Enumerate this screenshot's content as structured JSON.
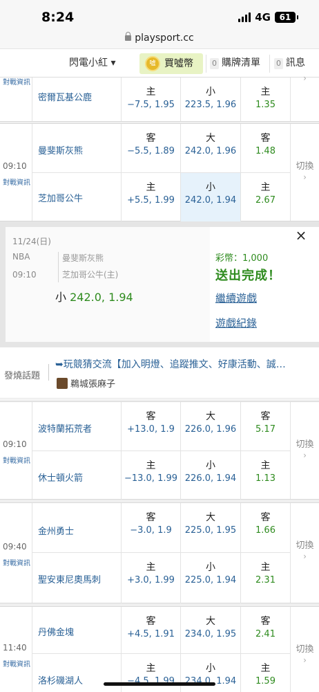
{
  "status_bar": {
    "time": "8:24",
    "network": "4G",
    "battery": "61"
  },
  "url": "playsport.cc",
  "nav": {
    "menu_label": "閃電小紅 ▾",
    "buy_label": "買噓幣",
    "coin_icon_text": "噓",
    "cart_count": "0",
    "cart_label": "購牌清單",
    "msg_count": "0",
    "msg_label": "訊息"
  },
  "labels": {
    "info": "對戰資訊",
    "switch": "切換",
    "switch_arrow": "›"
  },
  "game_top": {
    "team": "密爾瓦基公鹿",
    "col1": [
      "主",
      "−7.5, 1.95"
    ],
    "col2": [
      "小",
      "223.5, 1.96"
    ],
    "col3": [
      "主",
      "1.35"
    ]
  },
  "games": [
    {
      "time": "09:10",
      "away": {
        "team": "曼斐斯灰熊",
        "c1": [
          "客",
          "−5.5, 1.89"
        ],
        "c2": [
          "大",
          "242.0, 1.96"
        ],
        "c3": [
          "客",
          "1.48"
        ]
      },
      "home": {
        "team": "芝加哥公牛",
        "c1": [
          "主",
          "+5.5, 1.99"
        ],
        "c2": [
          "小",
          "242.0, 1.94"
        ],
        "c3": [
          "主",
          "2.67"
        ]
      }
    },
    {
      "time": "09:10",
      "away": {
        "team": "波特蘭拓荒者",
        "c1": [
          "客",
          "+13.0, 1.9"
        ],
        "c2": [
          "大",
          "226.0, 1.96"
        ],
        "c3": [
          "客",
          "5.17"
        ]
      },
      "home": {
        "team": "休士頓火箭",
        "c1": [
          "主",
          "−13.0, 1.99"
        ],
        "c2": [
          "小",
          "226.0, 1.94"
        ],
        "c3": [
          "主",
          "1.13"
        ]
      }
    },
    {
      "time": "09:40",
      "away": {
        "team": "金州勇士",
        "c1": [
          "客",
          "−3.0, 1.9"
        ],
        "c2": [
          "大",
          "225.0, 1.95"
        ],
        "c3": [
          "客",
          "1.66"
        ]
      },
      "home": {
        "team": "聖安東尼奧馬刺",
        "c1": [
          "主",
          "+3.0, 1.99"
        ],
        "c2": [
          "小",
          "225.0, 1.94"
        ],
        "c3": [
          "主",
          "2.31"
        ]
      }
    },
    {
      "time": "11:40",
      "away": {
        "team": "丹佛金塊",
        "c1": [
          "客",
          "+4.5, 1.91"
        ],
        "c2": [
          "大",
          "234.0, 1.95"
        ],
        "c3": [
          "客",
          "2.41"
        ]
      },
      "home": {
        "team": "洛杉磯湖人",
        "c1": [
          "主",
          "−4.5, 1.99"
        ],
        "c2": [
          "小",
          "234.0, 1.94"
        ],
        "c3": [
          "主",
          "1.59"
        ]
      }
    }
  ],
  "confirm": {
    "date": "11/24(日)",
    "league": "NBA",
    "time": "09:10",
    "team1": "曼斐斯灰熊",
    "team2": "芝加哥公牛(主)",
    "pick_side": "小",
    "pick_value": "242.0, 1.94",
    "coins": "彩幣：1,000",
    "done": "送出完成！",
    "continue_link": "繼續遊戲",
    "record_link": "遊戲紀錄",
    "close": "×"
  },
  "hot": {
    "label": "發燒話題",
    "title": "➥玩競猜交流【加入明燈、追蹤推文、好康活動、誠…",
    "author": "鵜城張麻子"
  },
  "colors": {
    "link_blue": "#2a6196",
    "odds_green": "#2e8b1e",
    "selected_bg": "#e6f2fb"
  }
}
